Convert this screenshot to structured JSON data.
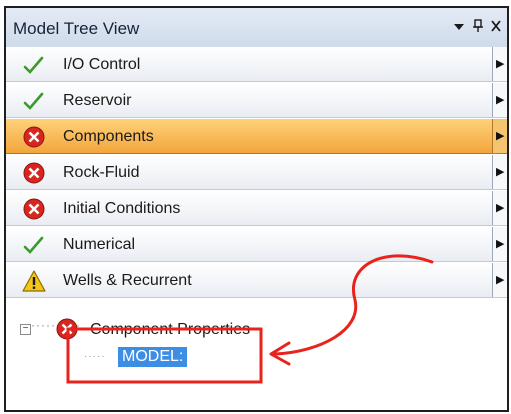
{
  "panel": {
    "title": "Model Tree View",
    "pin_icon": "pin-icon",
    "menu_icon": "dropdown-icon",
    "close_icon": "close-icon"
  },
  "nav": {
    "items": [
      {
        "label": "I/O Control",
        "status": "check-icon",
        "active": false
      },
      {
        "label": "Reservoir",
        "status": "check-icon",
        "active": false
      },
      {
        "label": "Components",
        "status": "error-icon",
        "active": true
      },
      {
        "label": "Rock-Fluid",
        "status": "error-icon",
        "active": false
      },
      {
        "label": "Initial Conditions",
        "status": "error-icon",
        "active": false
      },
      {
        "label": "Numerical",
        "status": "check-icon",
        "active": false
      },
      {
        "label": "Wells & Recurrent",
        "status": "warning-icon",
        "active": false
      }
    ]
  },
  "tree": {
    "root_label": "Component Properties",
    "root_status": "error-icon",
    "child_label": "MODEL:"
  },
  "colors": {
    "active_row": "#f3a53c",
    "selection": "#3c8de4",
    "annotation": "#e8231d"
  }
}
